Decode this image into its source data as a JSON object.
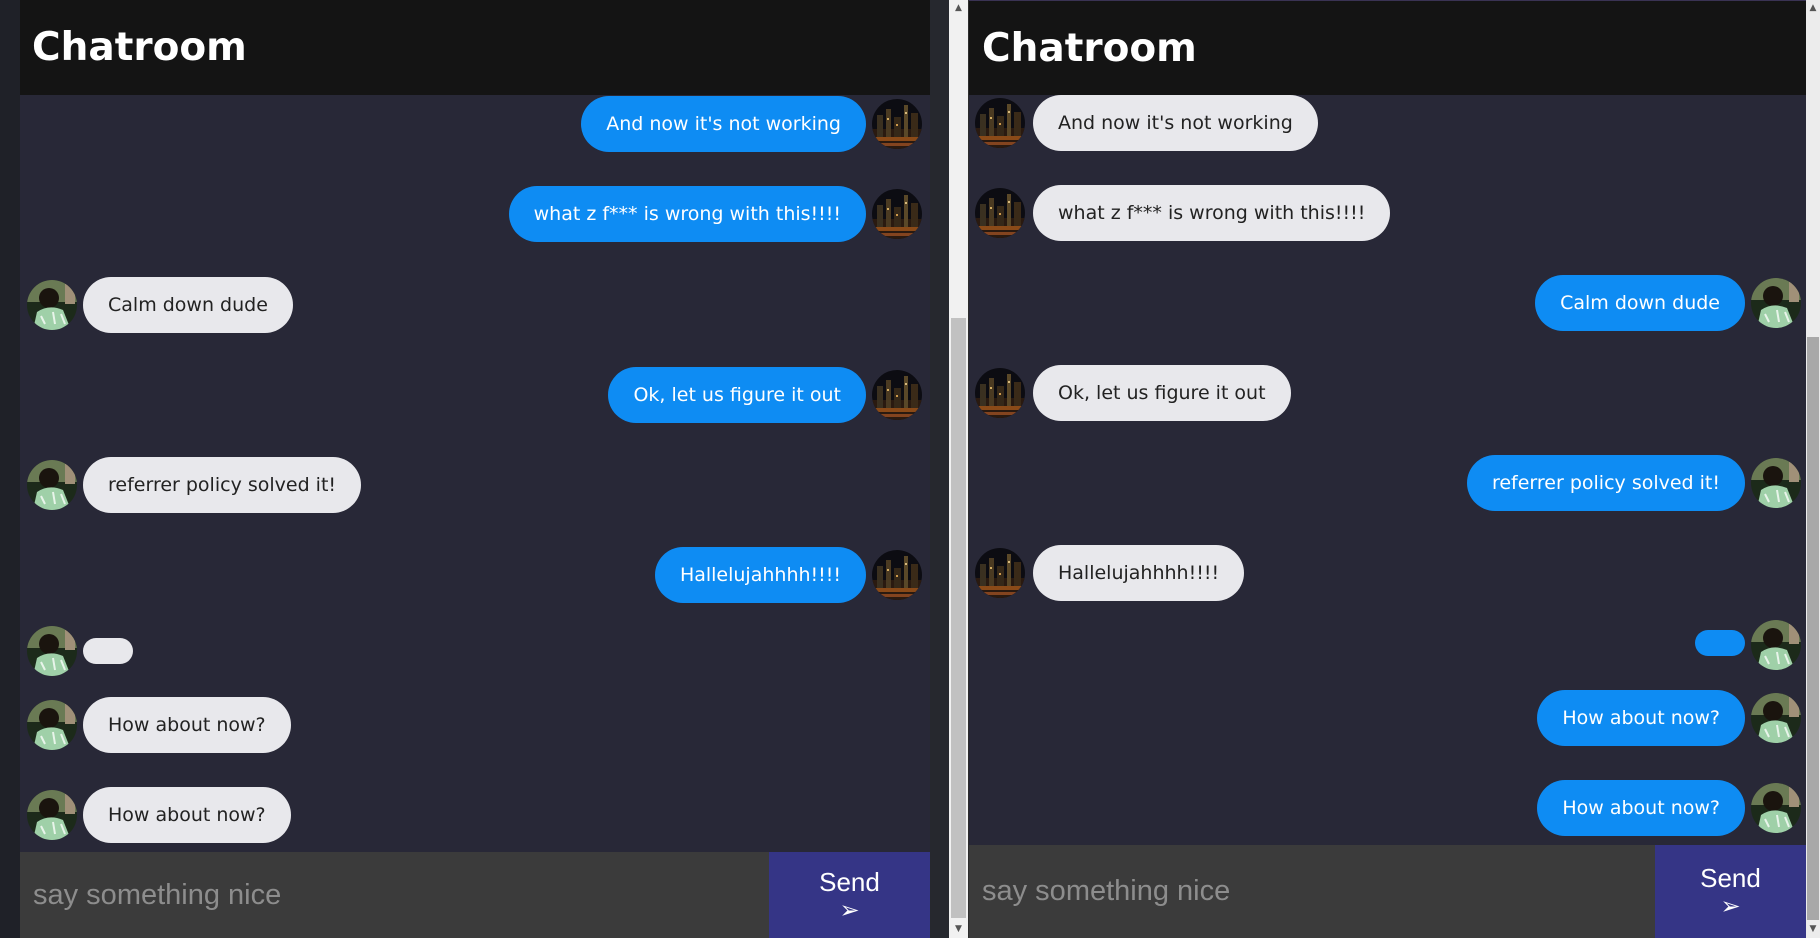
{
  "left": {
    "title": "Chatroom",
    "messages": [
      {
        "side": "self",
        "text": "And now it's not working"
      },
      {
        "side": "self",
        "text": "what z f*** is wrong with this!!!!"
      },
      {
        "side": "other",
        "text": "Calm down dude"
      },
      {
        "side": "self",
        "text": "Ok, let us figure it out"
      },
      {
        "side": "other",
        "text": "referrer policy solved it!"
      },
      {
        "side": "self",
        "text": "Hallelujahhhh!!!!"
      },
      {
        "side": "other",
        "text": ""
      },
      {
        "side": "other",
        "text": "How about now?"
      },
      {
        "side": "other",
        "text": "How about now?"
      }
    ],
    "input_placeholder": "say something nice",
    "input_value": "",
    "send_label": "Send",
    "send_icon": "➢"
  },
  "right": {
    "title": "Chatroom",
    "messages": [
      {
        "side": "other",
        "text": "And now it's not working"
      },
      {
        "side": "other",
        "text": "what z f*** is wrong with this!!!!"
      },
      {
        "side": "self",
        "text": "Calm down dude"
      },
      {
        "side": "other",
        "text": "Ok, let us figure it out"
      },
      {
        "side": "self",
        "text": "referrer policy solved it!"
      },
      {
        "side": "other",
        "text": "Hallelujahhhh!!!!"
      },
      {
        "side": "self",
        "text": ""
      },
      {
        "side": "self",
        "text": "How about now?"
      },
      {
        "side": "self",
        "text": "How about now?"
      }
    ],
    "input_placeholder": "say something nice",
    "input_value": "",
    "send_label": "Send",
    "send_icon": "➢"
  },
  "scrollbar": {
    "up": "▲",
    "down": "▼"
  },
  "colors": {
    "self_bubble": "#0e8cf3",
    "other_bubble": "#e8e8ec",
    "chat_background": "#282837",
    "header_background": "#141414",
    "send_button": "#353586",
    "composer_background": "#3b3b3b"
  },
  "avatars": {
    "city": "city-night-avatar",
    "person": "person-avatar"
  }
}
